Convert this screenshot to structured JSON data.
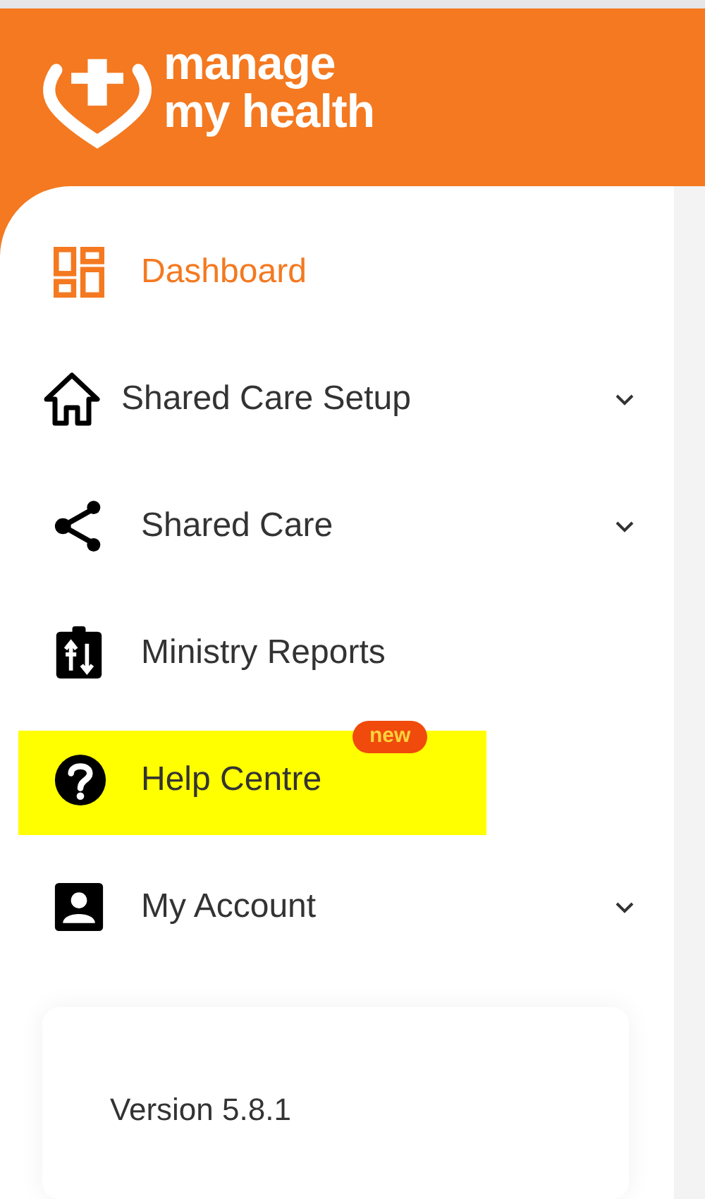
{
  "logo": {
    "line_1": "manage",
    "line_2": "my health"
  },
  "menu": [
    {
      "label": "Dashboard",
      "selected": true,
      "expandable": false,
      "highlighted": false
    },
    {
      "label": "Shared Care Setup",
      "selected": false,
      "expandable": true,
      "highlighted": false
    },
    {
      "label": "Shared Care",
      "selected": false,
      "expandable": true,
      "highlighted": false
    },
    {
      "label": "Ministry Reports",
      "selected": false,
      "expandable": false,
      "highlighted": false
    },
    {
      "label": "Help Centre",
      "selected": false,
      "expandable": false,
      "highlighted": true,
      "badge": "new"
    },
    {
      "label": "My Account",
      "selected": false,
      "expandable": true,
      "highlighted": false
    }
  ],
  "version": "Version 5.8.1"
}
